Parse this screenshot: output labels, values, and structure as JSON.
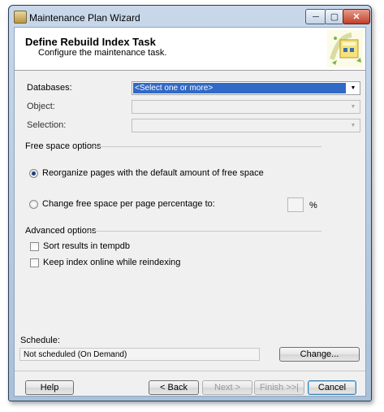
{
  "window": {
    "title": "Maintenance Plan Wizard",
    "controls": {
      "minimize": "─",
      "maximize": "▢",
      "close": "✕"
    }
  },
  "header": {
    "title": "Define Rebuild Index Task",
    "subtitle": "Configure the maintenance task."
  },
  "form": {
    "databases": {
      "label": "Databases:",
      "value": "<Select one or more>"
    },
    "object": {
      "label": "Object:",
      "value": ""
    },
    "selection": {
      "label": "Selection:",
      "value": ""
    },
    "dropdown_arrow": "▼"
  },
  "free_space": {
    "group_label": "Free space options",
    "option_default": "Reorganize pages with the default amount of free space",
    "option_change": "Change free space per page percentage to:",
    "selected": "option_default",
    "percent_value": "",
    "percent_unit": "%"
  },
  "advanced": {
    "group_label": "Advanced options",
    "sort_tempdb": {
      "label": "Sort results in tempdb",
      "checked": false
    },
    "keep_online": {
      "label": "Keep index online while reindexing",
      "checked": false
    }
  },
  "schedule": {
    "label": "Schedule:",
    "value": "Not scheduled (On Demand)",
    "change_button": "Change..."
  },
  "footer": {
    "help": "Help",
    "back": "< Back",
    "next": "Next >",
    "finish": "Finish >>|",
    "cancel": "Cancel"
  },
  "colors": {
    "selection_highlight": "#3169c6",
    "title_gradient_top": "#c8d8ea",
    "close_button": "#c0402a"
  },
  "icons": {
    "app": "maintenance-plan-icon",
    "wizard_graphic": "wizard-illustration-icon"
  }
}
